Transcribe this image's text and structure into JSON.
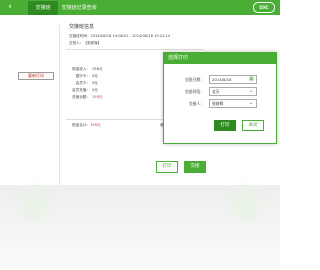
{
  "header": {
    "back_icon": "chevron-left-icon",
    "tabs": [
      {
        "label": "交接班"
      },
      {
        "label": "交接班记录查询"
      }
    ],
    "logo_text": "DXC",
    "accent_color": "#4aad35"
  },
  "left": {
    "reprint_label": "重新打印"
  },
  "info": {
    "title": "交接班信息",
    "period_label": "交接班时间：",
    "period_value": "2014/08/18 19:08:01 - 2014/08/18 19:22:14",
    "handover_label": "交班人：",
    "handover_value": "【张前辉】",
    "rows": [
      {
        "label": "现金收入：",
        "value": "158元",
        "red": false
      },
      {
        "label": "银行卡：",
        "value": "0元",
        "red": false
      },
      {
        "label": "会员卡：",
        "value": "0元",
        "red": false
      },
      {
        "label": "会员充值：",
        "value": "0元",
        "red": false
      },
      {
        "label": "总营业额：",
        "value": "158元",
        "red": true
      }
    ],
    "cash_label": "现金合计：",
    "cash_value": "158元",
    "diff_label": "差额：",
    "diff_value": "0元"
  },
  "actions": {
    "print_label": "打印",
    "handover_label": "交接"
  },
  "dialog": {
    "title": "选择打印",
    "date_label": "交班日期：",
    "date_value": "2014/8/18",
    "period_label": "交班时段：",
    "period_value": "全天",
    "person_label": "交接人：",
    "person_value": "张前辉",
    "print_label": "打印",
    "close_label": "关闭"
  }
}
